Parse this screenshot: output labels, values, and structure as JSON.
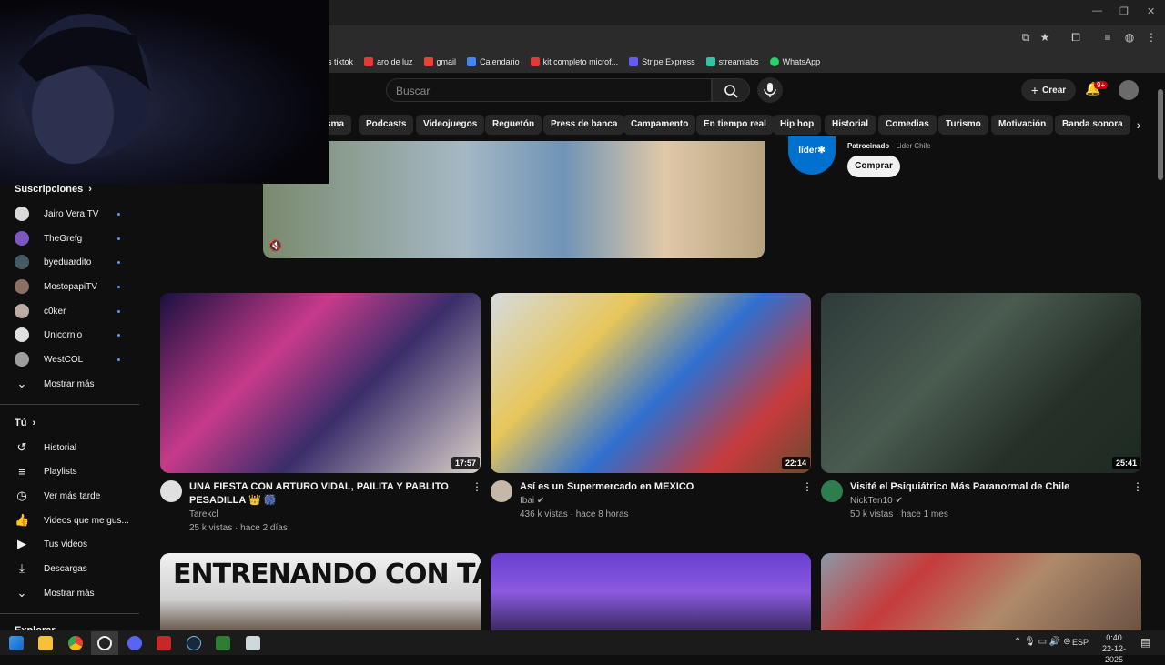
{
  "bookmarks": [
    {
      "label": "s tiktok",
      "color": "#2b2b2b"
    },
    {
      "label": "aro de luz",
      "color": "#e53935"
    },
    {
      "label": "gmail",
      "color": "#ea4335"
    },
    {
      "label": "Calendario",
      "color": "#4285f4"
    },
    {
      "label": "kit completo microf...",
      "color": "#e53935"
    },
    {
      "label": "Stripe Express",
      "color": "#635bff"
    },
    {
      "label": "streamlabs",
      "color": "#31c3a2"
    },
    {
      "label": "WhatsApp",
      "color": "#25d366"
    }
  ],
  "header": {
    "search_placeholder": "Buscar",
    "create_label": "Crear",
    "notifications_badge": "9+"
  },
  "chips": [
    "sma",
    "Podcasts",
    "Videojuegos",
    "Reguetón",
    "Press de banca",
    "Campamento",
    "En tiempo real",
    "Hip hop",
    "Historial",
    "Comedias",
    "Turismo",
    "Motivación",
    "Banda sonora"
  ],
  "ad": {
    "logo_text": "líder✱",
    "sponsored_label": "Patrocinado",
    "advertiser": "Lider Chile",
    "cta": "Comprar"
  },
  "sidebar": {
    "subscriptions_title": "Suscripciones",
    "channels": [
      {
        "name": "Jairo Vera TV",
        "color": "#d9d9d9"
      },
      {
        "name": "TheGrefg",
        "color": "#7e57c2"
      },
      {
        "name": "byeduardito",
        "color": "#455a64"
      },
      {
        "name": "MostopapiTV",
        "color": "#8d6e63"
      },
      {
        "name": "c0ker",
        "color": "#bcaaa4"
      },
      {
        "name": "Unicornio",
        "color": "#e0e0e0"
      },
      {
        "name": "WestCOL",
        "color": "#9e9e9e"
      }
    ],
    "show_more_subs": "Mostrar más",
    "you_title": "Tú",
    "you_items": [
      {
        "label": "Historial",
        "icon": "history-icon"
      },
      {
        "label": "Playlists",
        "icon": "playlist-icon"
      },
      {
        "label": "Ver más tarde",
        "icon": "clock-icon"
      },
      {
        "label": "Videos que me gus...",
        "icon": "thumbs-up-icon"
      },
      {
        "label": "Tus videos",
        "icon": "video-icon"
      },
      {
        "label": "Descargas",
        "icon": "download-icon"
      }
    ],
    "show_more_you": "Mostrar más",
    "explore_title": "Explorar"
  },
  "videos": [
    {
      "title": "UNA FIESTA CON ARTURO VIDAL, PAILITA Y PABLITO PESADILLA 👑 🎆",
      "channel": "Tarekcl",
      "verified": false,
      "meta": "25 k vistas · hace 2 días",
      "duration": "17:57",
      "avatar_color": "#e0e0e0",
      "thumb_bg": "linear-gradient(135deg,#1a1040 0%,#c73a8a 35%,#3a2d6b 60%,#d8d0c8 100%)"
    },
    {
      "title": "Así es un Supermercado en MEXICO",
      "channel": "Ibai",
      "verified": true,
      "meta": "436 k vistas · hace 8 horas",
      "duration": "22:14",
      "avatar_color": "#c5b8a8",
      "thumb_bg": "linear-gradient(135deg,#d5dbe0 0%,#e7c65a 30%,#2f6fd0 55%,#c83a3a 80%,#6a4a32 100%)"
    },
    {
      "title": "Visité el Psiquiátrico Más Paranormal de Chile",
      "channel": "NickTen10",
      "verified": true,
      "meta": "50 k vistas · hace 1 mes",
      "duration": "25:41",
      "avatar_color": "#2e7d4f",
      "thumb_bg": "linear-gradient(135deg,#2d3b3a 0%,#4a5b50 40%,#253028 70%,#1d2a22 100%)"
    }
  ],
  "row2": [
    {
      "thumb_text": "ENTRENANDO CON TADE",
      "thumb_bg": "linear-gradient(180deg,#f2f2f2 0%,#cfcfcf 60%,#6b5a4e 100%)"
    },
    {
      "thumb_text": "",
      "thumb_bg": "linear-gradient(180deg,#6a3fd0 0%,#8a5ae0 50%,#3a2a60 100%)"
    },
    {
      "thumb_text": "",
      "thumb_bg": "linear-gradient(135deg,#8a9aa8 0%,#c63b3b 30%,#b08a6a 60%,#6a5244 100%)"
    }
  ],
  "taskbar": {
    "time": "0:40",
    "date": "22-12-2025",
    "lang": "ESP"
  }
}
